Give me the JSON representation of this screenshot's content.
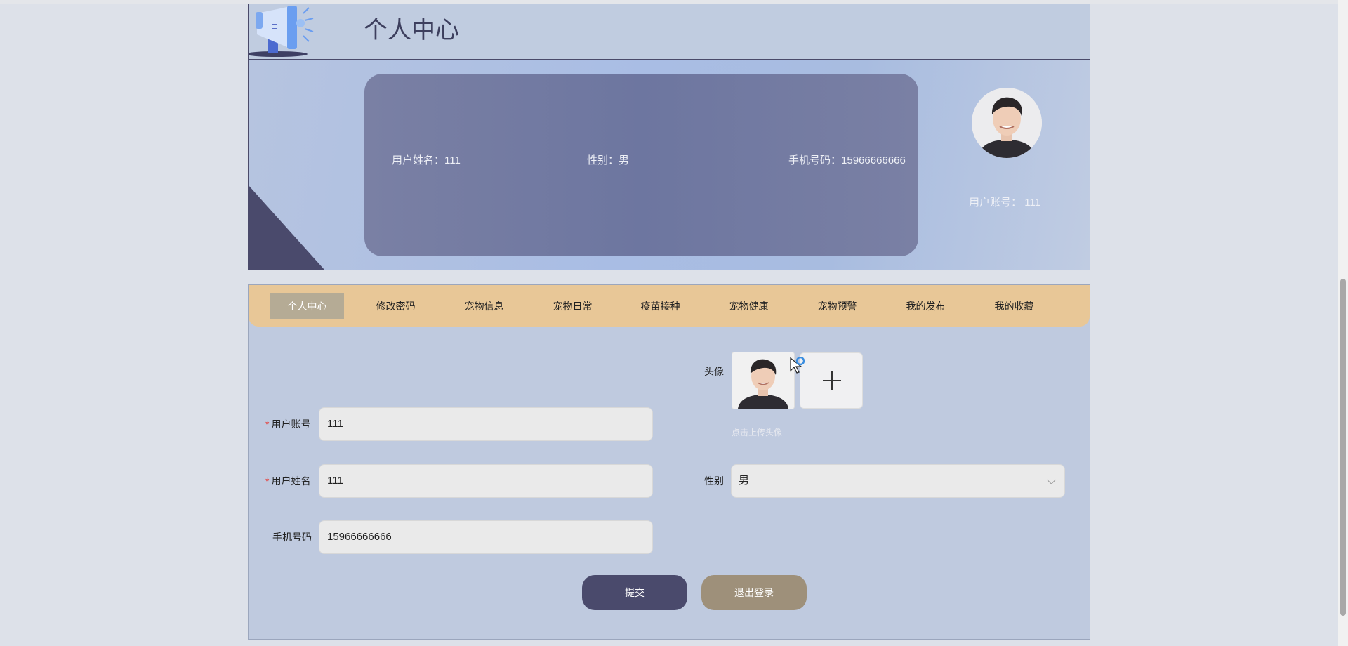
{
  "header": {
    "title": "个人中心",
    "icon": "megaphone-icon"
  },
  "banner": {
    "name_label": "用户姓名：",
    "name_value": "111",
    "gender_label": "性别：",
    "gender_value": "男",
    "phone_label": "手机号码：",
    "phone_value": "15966666666",
    "account_label": "用户账号：",
    "account_value": "111"
  },
  "tabs": [
    {
      "label": "个人中心",
      "active": true
    },
    {
      "label": "修改密码"
    },
    {
      "label": "宠物信息"
    },
    {
      "label": "宠物日常"
    },
    {
      "label": "疫苗接种"
    },
    {
      "label": "宠物健康"
    },
    {
      "label": "宠物预警"
    },
    {
      "label": "我的发布"
    },
    {
      "label": "我的收藏"
    }
  ],
  "form": {
    "avatar_label": "头像",
    "avatar_hint": "点击上传头像",
    "account_label": "用户账号",
    "account_value": "111",
    "name_label": "用户姓名",
    "name_value": "111",
    "phone_label": "手机号码",
    "phone_value": "15966666666",
    "gender_label": "性别",
    "gender_value": "男",
    "required_mark": "*"
  },
  "buttons": {
    "submit": "提交",
    "logout": "退出登录"
  },
  "colors": {
    "accent_dark": "#4a4a6c",
    "tab_bar": "#e8c797",
    "tab_active": "#b5ab95",
    "logout": "#9e907a"
  }
}
